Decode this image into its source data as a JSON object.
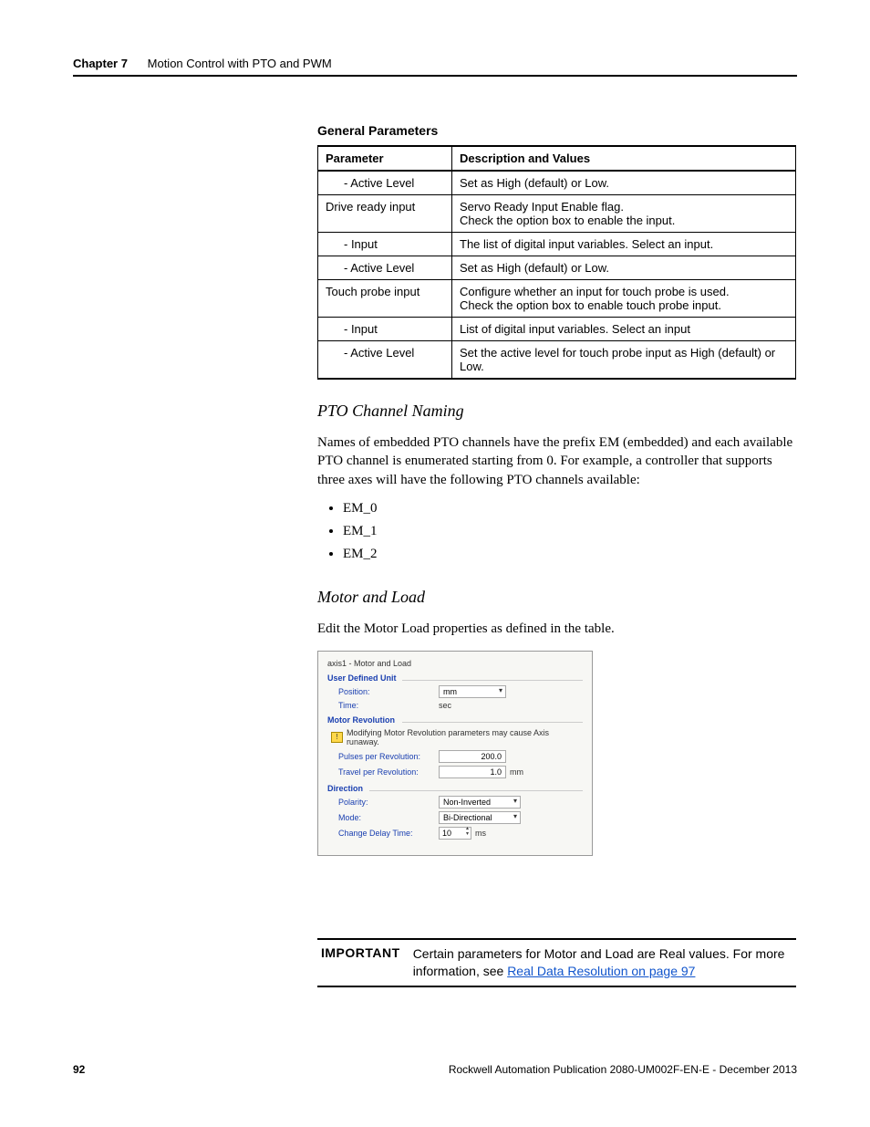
{
  "header": {
    "chapter": "Chapter 7",
    "title": "Motion Control with PTO and PWM"
  },
  "table": {
    "caption": "General Parameters",
    "head": {
      "c1": "Parameter",
      "c2": "Description and Values"
    },
    "rows": [
      {
        "c1": "- Active Level",
        "c2": "Set as High (default) or Low.",
        "indent": true
      },
      {
        "c1": "Drive ready input",
        "c2": "Servo Ready Input Enable flag.\nCheck the option box to enable the input.",
        "indent": false
      },
      {
        "c1": "- Input",
        "c2": "The list of digital input variables. Select an input.",
        "indent": true
      },
      {
        "c1": "- Active Level",
        "c2": "Set as High (default) or Low.",
        "indent": true
      },
      {
        "c1": "Touch probe input",
        "c2": "Configure whether an input for touch probe is used.\nCheck the option box to enable touch probe input.",
        "indent": false
      },
      {
        "c1": "- Input",
        "c2": "List of digital input variables. Select an input",
        "indent": true
      },
      {
        "c1": "- Active Level",
        "c2": "Set the active level for touch probe input as High (default) or Low.",
        "indent": true
      }
    ]
  },
  "pto": {
    "heading": "PTO Channel Naming",
    "para": "Names of embedded PTO channels have the prefix EM (embedded) and each available PTO channel is enumerated starting from 0. For example, a controller that supports three axes will have the following PTO channels available:",
    "items": [
      "EM_0",
      "EM_1",
      "EM_2"
    ]
  },
  "motor": {
    "heading": "Motor and Load",
    "para": "Edit the Motor Load properties as defined in the table."
  },
  "shot": {
    "title": "axis1 - Motor and Load",
    "g1": "User Defined Unit",
    "pos_lab": "Position:",
    "pos_val": "mm",
    "time_lab": "Time:",
    "time_val": "sec",
    "g2": "Motor Revolution",
    "warn": "Modifying Motor Revolution parameters may cause Axis runaway.",
    "ppr_lab": "Pulses per Revolution:",
    "ppr_val": "200.0",
    "tpr_lab": "Travel per Revolution:",
    "tpr_val": "1.0",
    "tpr_unit": "mm",
    "g3": "Direction",
    "pol_lab": "Polarity:",
    "pol_val": "Non-Inverted",
    "mode_lab": "Mode:",
    "mode_val": "Bi-Directional",
    "cdt_lab": "Change Delay Time:",
    "cdt_val": "10",
    "cdt_unit": "ms"
  },
  "important": {
    "label": "IMPORTANT",
    "text": "Certain parameters for Motor and Load are Real values. For more information, see ",
    "link": "Real Data Resolution on page 97"
  },
  "footer": {
    "page": "92",
    "pub": "Rockwell Automation Publication 2080-UM002F-EN-E - December 2013"
  }
}
